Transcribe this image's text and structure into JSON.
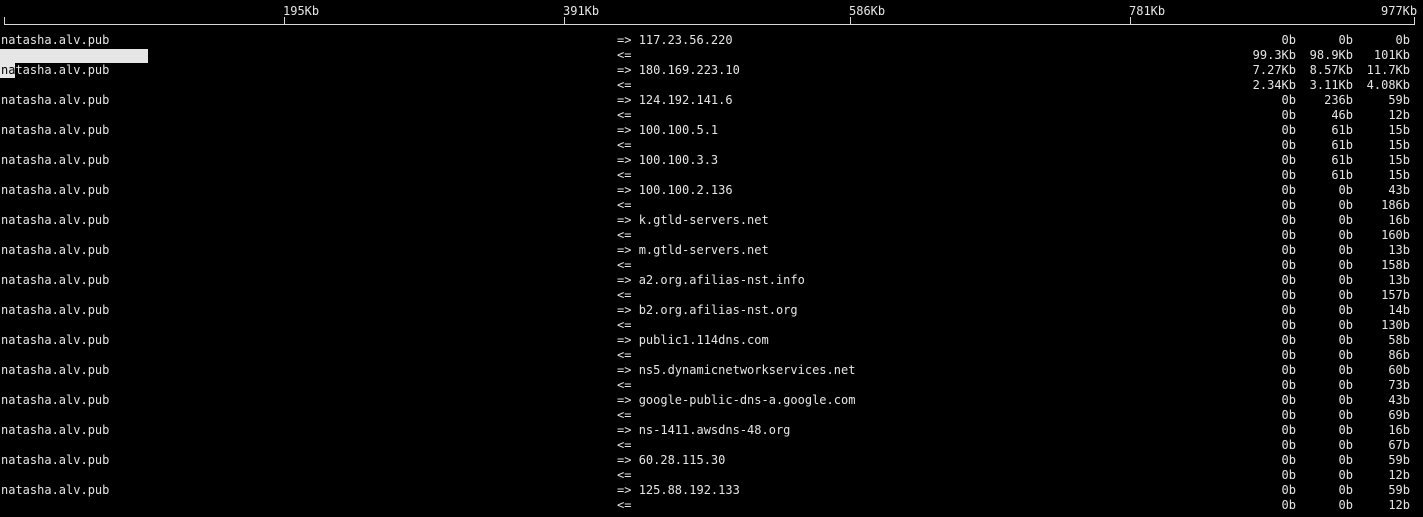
{
  "scale": {
    "labels": [
      "195Kb",
      "391Kb",
      "586Kb",
      "781Kb",
      "977Kb"
    ]
  },
  "flows": [
    {
      "source": "natasha.alv.pub",
      "dest": "117.23.56.220",
      "out_arrow": "=>",
      "in_arrow": "<=",
      "sent": [
        "0b",
        "0b",
        "0b"
      ],
      "recv": [
        "99.3Kb",
        "98.9Kb",
        "101Kb"
      ]
    },
    {
      "source": "natasha.alv.pub",
      "dest": "180.169.223.10",
      "out_arrow": "=>",
      "in_arrow": "<=",
      "sent": [
        "7.27Kb",
        "8.57Kb",
        "11.7Kb"
      ],
      "recv": [
        "2.34Kb",
        "3.11Kb",
        "4.08Kb"
      ]
    },
    {
      "source": "natasha.alv.pub",
      "dest": "124.192.141.6",
      "out_arrow": "=>",
      "in_arrow": "<=",
      "sent": [
        "0b",
        "236b",
        "59b"
      ],
      "recv": [
        "0b",
        "46b",
        "12b"
      ]
    },
    {
      "source": "natasha.alv.pub",
      "dest": "100.100.5.1",
      "out_arrow": "=>",
      "in_arrow": "<=",
      "sent": [
        "0b",
        "61b",
        "15b"
      ],
      "recv": [
        "0b",
        "61b",
        "15b"
      ]
    },
    {
      "source": "natasha.alv.pub",
      "dest": "100.100.3.3",
      "out_arrow": "=>",
      "in_arrow": "<=",
      "sent": [
        "0b",
        "61b",
        "15b"
      ],
      "recv": [
        "0b",
        "61b",
        "15b"
      ]
    },
    {
      "source": "natasha.alv.pub",
      "dest": "100.100.2.136",
      "out_arrow": "=>",
      "in_arrow": "<=",
      "sent": [
        "0b",
        "0b",
        "43b"
      ],
      "recv": [
        "0b",
        "0b",
        "186b"
      ]
    },
    {
      "source": "natasha.alv.pub",
      "dest": "k.gtld-servers.net",
      "out_arrow": "=>",
      "in_arrow": "<=",
      "sent": [
        "0b",
        "0b",
        "16b"
      ],
      "recv": [
        "0b",
        "0b",
        "160b"
      ]
    },
    {
      "source": "natasha.alv.pub",
      "dest": "m.gtld-servers.net",
      "out_arrow": "=>",
      "in_arrow": "<=",
      "sent": [
        "0b",
        "0b",
        "13b"
      ],
      "recv": [
        "0b",
        "0b",
        "158b"
      ]
    },
    {
      "source": "natasha.alv.pub",
      "dest": "a2.org.afilias-nst.info",
      "out_arrow": "=>",
      "in_arrow": "<=",
      "sent": [
        "0b",
        "0b",
        "13b"
      ],
      "recv": [
        "0b",
        "0b",
        "157b"
      ]
    },
    {
      "source": "natasha.alv.pub",
      "dest": "b2.org.afilias-nst.org",
      "out_arrow": "=>",
      "in_arrow": "<=",
      "sent": [
        "0b",
        "0b",
        "14b"
      ],
      "recv": [
        "0b",
        "0b",
        "130b"
      ]
    },
    {
      "source": "natasha.alv.pub",
      "dest": "public1.114dns.com",
      "out_arrow": "=>",
      "in_arrow": "<=",
      "sent": [
        "0b",
        "0b",
        "58b"
      ],
      "recv": [
        "0b",
        "0b",
        "86b"
      ]
    },
    {
      "source": "natasha.alv.pub",
      "dest": "ns5.dynamicnetworkservices.net",
      "out_arrow": "=>",
      "in_arrow": "<=",
      "sent": [
        "0b",
        "0b",
        "60b"
      ],
      "recv": [
        "0b",
        "0b",
        "73b"
      ]
    },
    {
      "source": "natasha.alv.pub",
      "dest": "google-public-dns-a.google.com",
      "out_arrow": "=>",
      "in_arrow": "<=",
      "sent": [
        "0b",
        "0b",
        "43b"
      ],
      "recv": [
        "0b",
        "0b",
        "69b"
      ]
    },
    {
      "source": "natasha.alv.pub",
      "dest": "ns-1411.awsdns-48.org",
      "out_arrow": "=>",
      "in_arrow": "<=",
      "sent": [
        "0b",
        "0b",
        "16b"
      ],
      "recv": [
        "0b",
        "0b",
        "67b"
      ]
    },
    {
      "source": "natasha.alv.pub",
      "dest": "60.28.115.30",
      "out_arrow": "=>",
      "in_arrow": "<=",
      "sent": [
        "0b",
        "0b",
        "59b"
      ],
      "recv": [
        "0b",
        "0b",
        "12b"
      ]
    },
    {
      "source": "natasha.alv.pub",
      "dest": "125.88.192.133",
      "out_arrow": "=>",
      "in_arrow": "<=",
      "sent": [
        "0b",
        "0b",
        "59b"
      ],
      "recv": [
        "0b",
        "0b",
        "12b"
      ]
    }
  ]
}
